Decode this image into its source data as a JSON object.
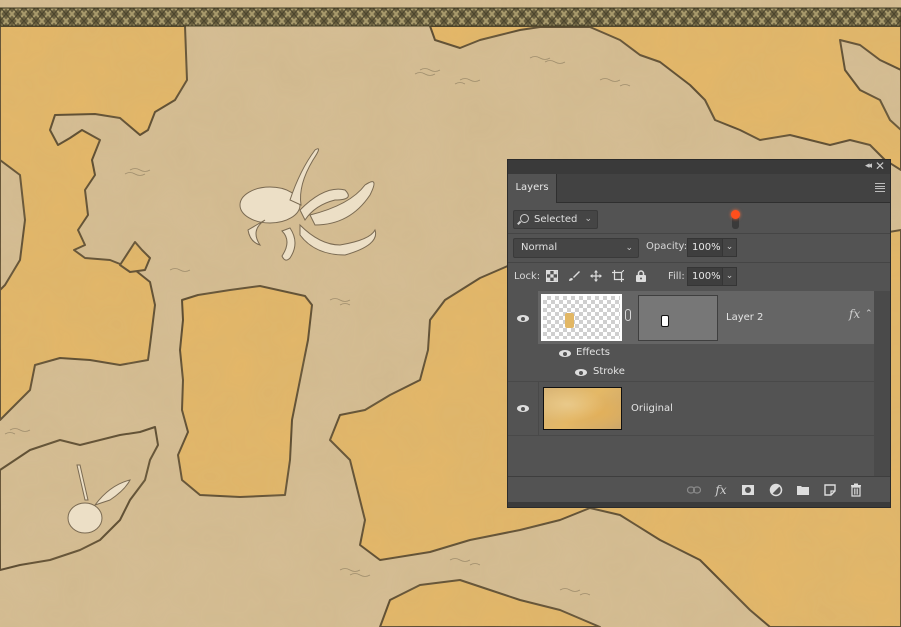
{
  "canvas": {
    "description": "Parchment fantasy map with Celtic-knot top border",
    "colors": {
      "land": "#e4b768",
      "sea": "#d5bd94",
      "coast": "#5a4a30",
      "border": "#5e5538"
    },
    "decorations": [
      "octopus-sea-monster",
      "sea-serpent-ship"
    ]
  },
  "panel": {
    "title_tab": "Layers",
    "topbar": {
      "collapse_label": "◂◂",
      "close_label": "✕"
    },
    "filter": {
      "kind_label": "Selected",
      "toggle_state": "on",
      "toggle_color": "#ff4f1c"
    },
    "blend": {
      "mode": "Normal",
      "opacity_label": "Opacity:",
      "opacity_value": "100%"
    },
    "lock": {
      "label": "Lock:",
      "icons": [
        "lock-transparent-pixels",
        "lock-image-pixels",
        "lock-position",
        "lock-artboard",
        "lock-all"
      ],
      "fill_label": "Fill:",
      "fill_value": "100%"
    },
    "layers": [
      {
        "name": "Layer 2",
        "visible": true,
        "selected": true,
        "has_mask": true,
        "fx_badge": "fx",
        "effects_label": "Effects",
        "effects": [
          {
            "name": "Stroke",
            "visible": true
          }
        ]
      },
      {
        "name": "Oriiginal",
        "visible": true,
        "selected": false
      }
    ],
    "footer_icons": [
      "link-layers",
      "add-layer-style",
      "add-mask",
      "new-adjustment-layer",
      "new-group",
      "new-layer",
      "delete-layer"
    ],
    "footer_fx_label": "fx"
  }
}
